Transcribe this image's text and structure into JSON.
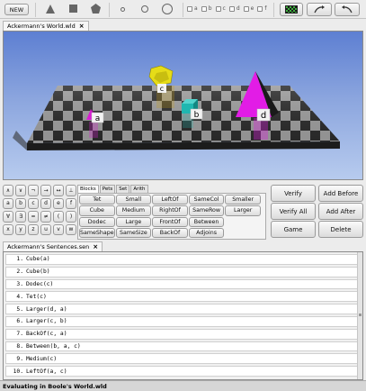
{
  "toolbar": {
    "new": "NEW",
    "size_checks": [
      "a",
      "b",
      "c",
      "d",
      "e",
      "f"
    ]
  },
  "world": {
    "tab": "Ackermann's World.wld",
    "labels": {
      "a": "a",
      "b": "b",
      "c": "c",
      "d": "d"
    }
  },
  "keypad": [
    "∧",
    "∨",
    "¬",
    "→",
    "↔",
    "⊥",
    "a",
    "b",
    "c",
    "d",
    "e",
    "f",
    "∀",
    "∃",
    "=",
    "≠",
    "(",
    ")",
    "x",
    "y",
    "z",
    "u",
    "v",
    "w"
  ],
  "predicate_tabs": [
    "Blocks",
    "Pets",
    "Set",
    "Arith"
  ],
  "predicates": [
    "Tet",
    "Small",
    "LeftOf",
    "SameCol",
    "Smaller",
    "Cube",
    "Medium",
    "RightOf",
    "SameRow",
    "Larger",
    "Dodec",
    "Large",
    "FrontOf",
    "Between",
    "",
    "SameShape",
    "SameSize",
    "BackOf",
    "Adjoins",
    ""
  ],
  "actions": [
    "Verify",
    "Add Before",
    "Verify All",
    "Add After",
    "Game",
    "Delete"
  ],
  "sentences": {
    "tab": "Ackermann's Sentences.sen",
    "items": [
      {
        "num": "1.",
        "text": "Cube(a)"
      },
      {
        "num": "2.",
        "text": "Cube(b)"
      },
      {
        "num": "3.",
        "text": "Dodec(c)"
      },
      {
        "num": "4.",
        "text": "Tet(c)"
      },
      {
        "num": "5.",
        "text": "Larger(d, a)"
      },
      {
        "num": "6.",
        "text": "Larger(c, b)"
      },
      {
        "num": "7.",
        "text": "BackOf(c, a)"
      },
      {
        "num": "8.",
        "text": "Between(b, a, c)"
      },
      {
        "num": "9.",
        "text": "Medium(c)"
      },
      {
        "num": "10.",
        "text": "LeftOf(a, c)"
      }
    ]
  },
  "status": "Evaluating in Boole's World.wld"
}
